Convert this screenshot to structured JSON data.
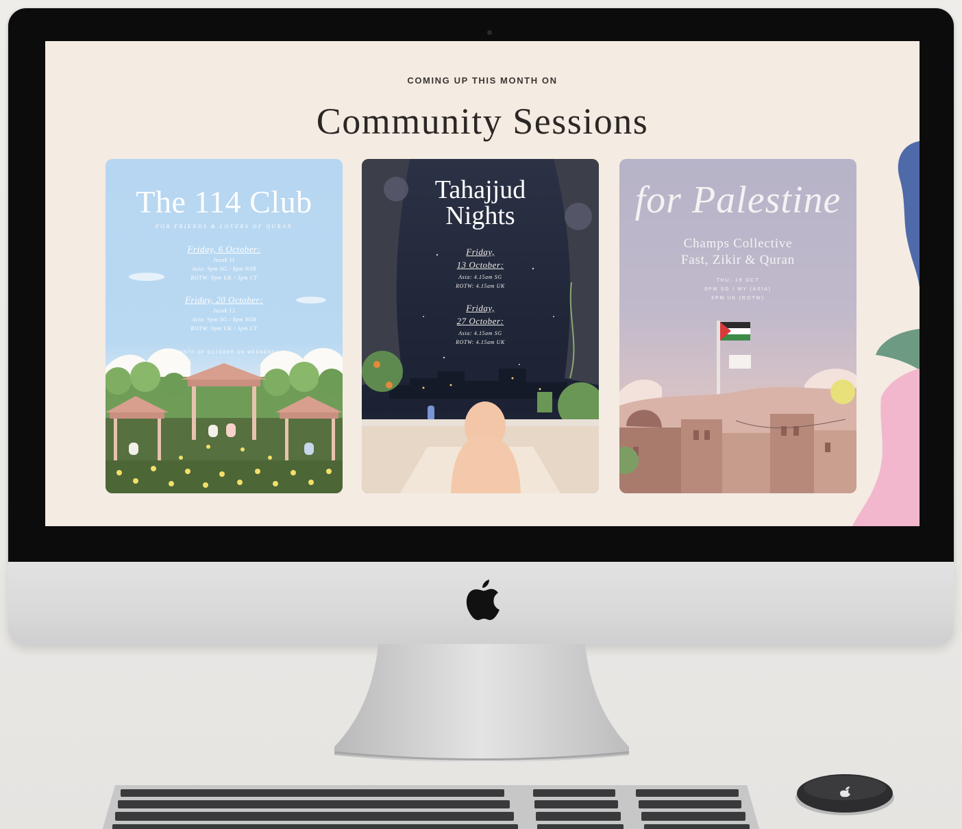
{
  "screen": {
    "eyebrow": "COMING UP THIS MONTH ON",
    "title": "Community Sessions"
  },
  "cards": [
    {
      "title": "The 114 Club",
      "subtitle": "FOR FRIENDS & LOVERS OF QURAN",
      "sessions": [
        {
          "date": "Friday, 6 October:",
          "lines": [
            "Juzuk 11",
            "Asia: 9pm SG / 8pm WIB",
            "ROTW: 9pm UK / 3pm CT"
          ]
        },
        {
          "date": "Friday, 20 October:",
          "lines": [
            "Juzuk 12",
            "Asia: 9pm SG / 8pm WIB",
            "ROTW: 9pm UK / 3pm CT"
          ]
        }
      ],
      "footer": "THE MONTH OF OCTOBER ON WEDNESDAYS"
    },
    {
      "title_line1": "Tahajjud",
      "title_line2": "Nights",
      "sessions": [
        {
          "date_line1": "Friday,",
          "date_line2": "13 October:",
          "lines": [
            "Asia: 4.15am SG",
            "ROTW: 4.15am UK"
          ]
        },
        {
          "date_line1": "Friday,",
          "date_line2": "27 October:",
          "lines": [
            "Asia: 4.15am SG",
            "ROTW: 4.15am UK"
          ]
        }
      ]
    },
    {
      "script_title": "for Palestine",
      "name_line1": "Champs Collective",
      "name_line2": "Fast, Zikir & Quran",
      "lines": [
        "THU, 19 OCT",
        "6PM SG / MY (ASIA)",
        "5PM UK (ROTW)"
      ]
    }
  ],
  "colors": {
    "screen_bg": "#f4ebe3",
    "card1_sky": "#b7d6f1",
    "card2_night": "#1f2638",
    "card3_dusk": "#bfb8cc",
    "bezel": "#0c0c0d",
    "aluminium": "#dcdcdd"
  },
  "icons": [
    "apple-logo-icon",
    "palestine-flag-icon"
  ]
}
